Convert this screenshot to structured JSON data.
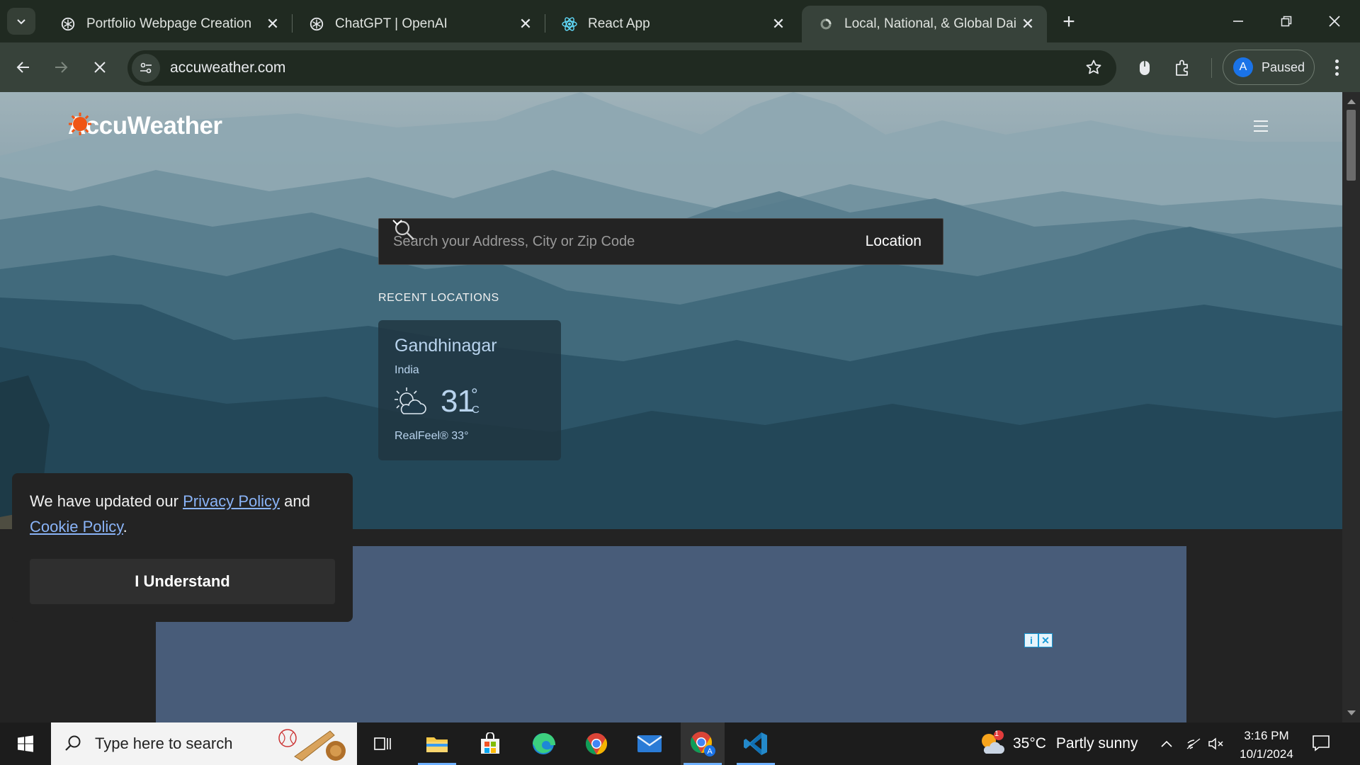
{
  "browser": {
    "tabs": [
      {
        "title": "Portfolio Webpage Creation",
        "icon": "openai-icon",
        "active": false
      },
      {
        "title": "ChatGPT | OpenAI",
        "icon": "openai-icon",
        "active": false
      },
      {
        "title": "React App",
        "icon": "react-icon",
        "active": false
      },
      {
        "title": "Local, National, & Global Daily \\",
        "icon": "loading-icon",
        "active": true
      }
    ],
    "url": "accuweather.com",
    "profile": {
      "initial": "A",
      "status": "Paused"
    }
  },
  "site": {
    "logo_text": "AccuWeather",
    "search": {
      "placeholder": "Search your Address, City or Zip Code",
      "location_label": "Location"
    },
    "recent_label": "RECENT LOCATIONS",
    "recent": [
      {
        "city": "Gandhinagar",
        "country": "India",
        "temp": "31",
        "unit": "C",
        "realfeel": "RealFeel® 33°",
        "icon": "partly-sunny-icon"
      }
    ],
    "cookie": {
      "text_before": "We have updated our ",
      "privacy_link": "Privacy Policy",
      "text_mid": " and ",
      "cookie_link": "Cookie Policy",
      "text_after": ".",
      "button": "I Understand"
    }
  },
  "taskbar": {
    "search_placeholder": "Type here to search",
    "weather": {
      "temp": "35°C",
      "desc": "Partly sunny",
      "badge": "1"
    },
    "time": "3:16 PM",
    "date": "10/1/2024"
  },
  "colors": {
    "accent_orange": "#f05514",
    "link_blue": "#8ab4f8",
    "ad_bg": "#485c79"
  }
}
